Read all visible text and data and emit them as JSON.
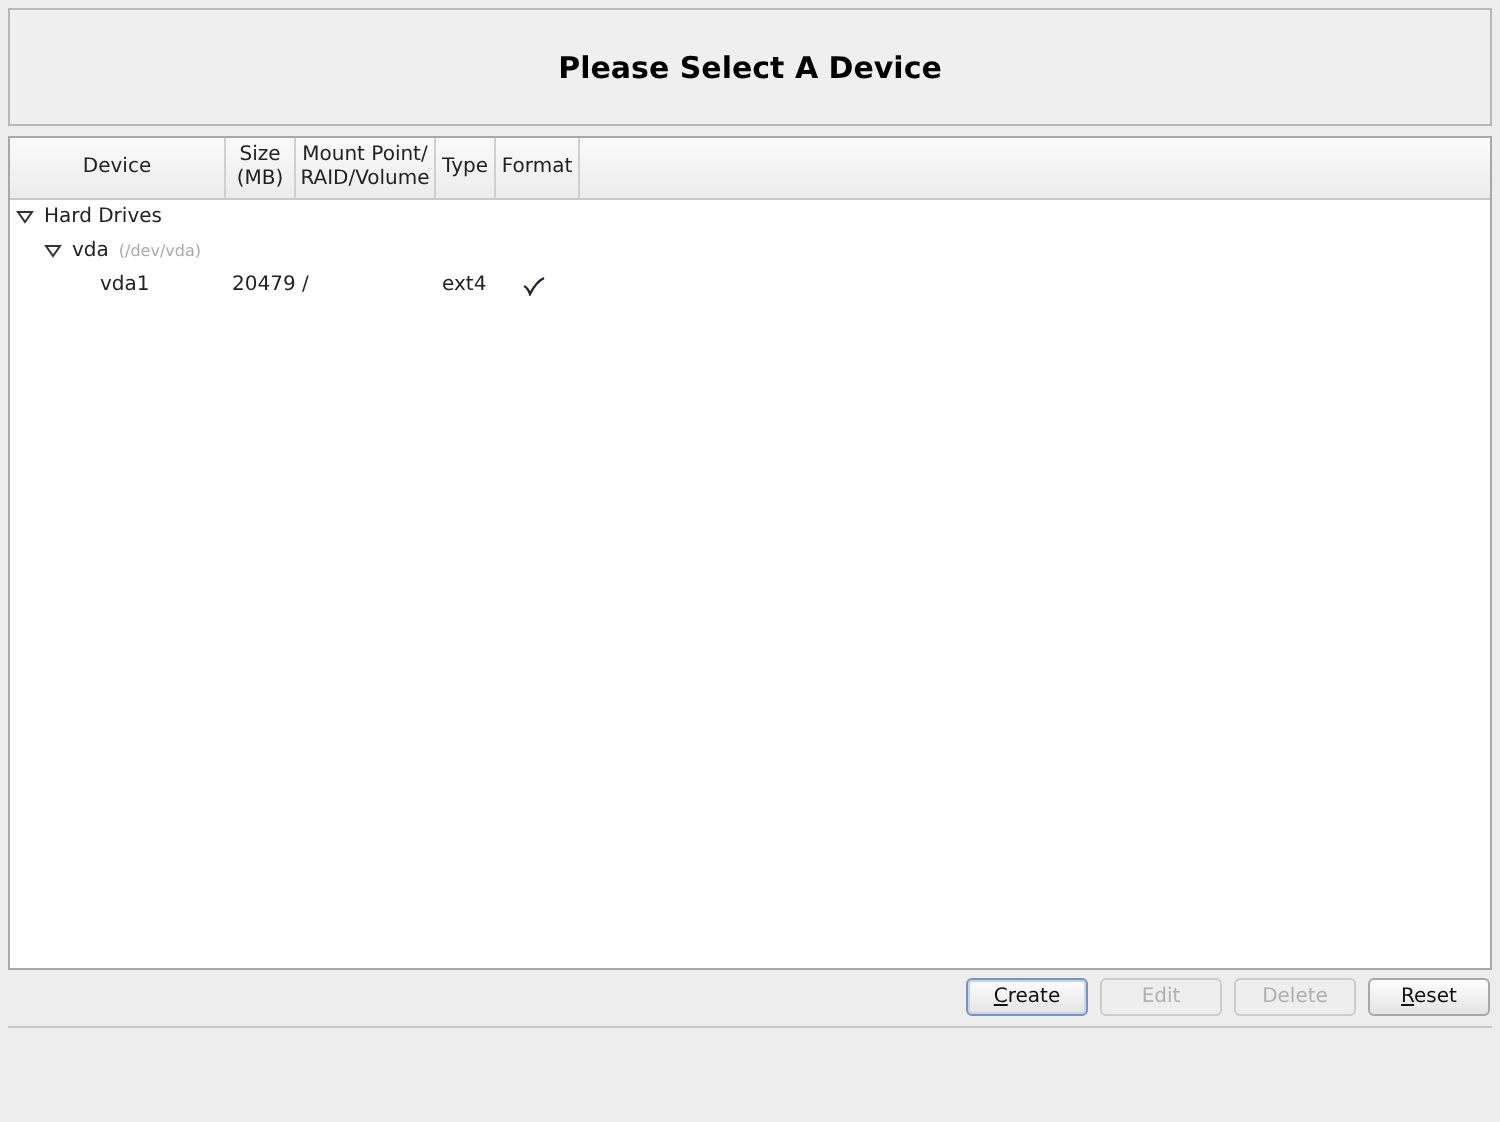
{
  "header": {
    "title": "Please Select A Device"
  },
  "table": {
    "columns": [
      {
        "label": "Device"
      },
      {
        "label": "Size\n(MB)"
      },
      {
        "label": "Mount Point/\nRAID/Volume"
      },
      {
        "label": "Type"
      },
      {
        "label": "Format"
      }
    ],
    "rows": [
      {
        "device": "Hard Drives",
        "expanded": true,
        "children": [
          {
            "device": "vda",
            "hint": "(/dev/vda)",
            "expanded": true,
            "children": [
              {
                "device": "vda1",
                "size": "20479",
                "mount": "/",
                "type": "ext4",
                "format": true
              }
            ]
          }
        ]
      }
    ]
  },
  "buttons": [
    {
      "label": "Create",
      "disabled": false,
      "focused": true
    },
    {
      "label": "Edit",
      "disabled": true,
      "focused": false
    },
    {
      "label": "Delete",
      "disabled": true,
      "focused": false
    },
    {
      "label": "Reset",
      "disabled": false,
      "focused": false
    }
  ]
}
